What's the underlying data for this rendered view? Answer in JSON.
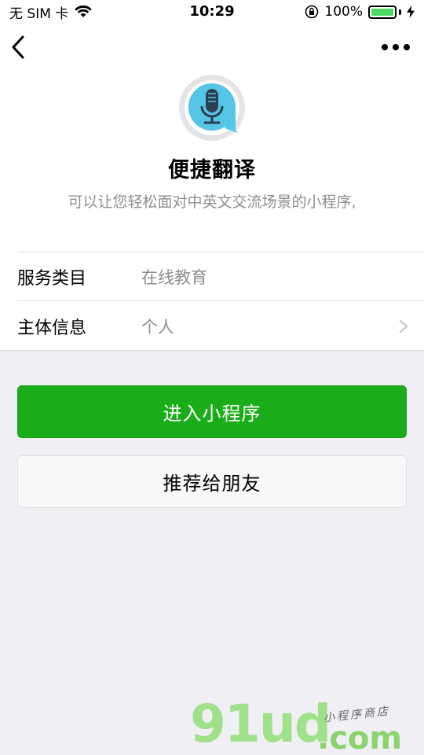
{
  "status_bar": {
    "carrier": "无 SIM 卡",
    "time": "10:29",
    "battery": "100%",
    "icons": [
      "wifi-icon",
      "orientation-lock-icon",
      "battery-icon",
      "charging-icon"
    ]
  },
  "nav": {
    "icons": [
      "back-arrow-icon",
      "more-dots-icon"
    ]
  },
  "profile": {
    "name": "便捷翻译",
    "description": "可以让您轻松面对中英文交流场景的小程序,",
    "logo_icon": "microphone-icon"
  },
  "info": {
    "rows": [
      {
        "label": "服务类目",
        "value": "在线教育"
      },
      {
        "label": "主体信息",
        "value": "个人"
      }
    ]
  },
  "buttons": {
    "enter": "进入小程序",
    "share": "推荐给朋友"
  },
  "watermark": {
    "logo": "91ud",
    "tagline": "小程序商店",
    "domain": ".com"
  },
  "colors": {
    "accent_green": "#1aad19",
    "battery_green": "#4cd964",
    "background": "#efeff4",
    "secondary_text": "#8e8e93"
  }
}
